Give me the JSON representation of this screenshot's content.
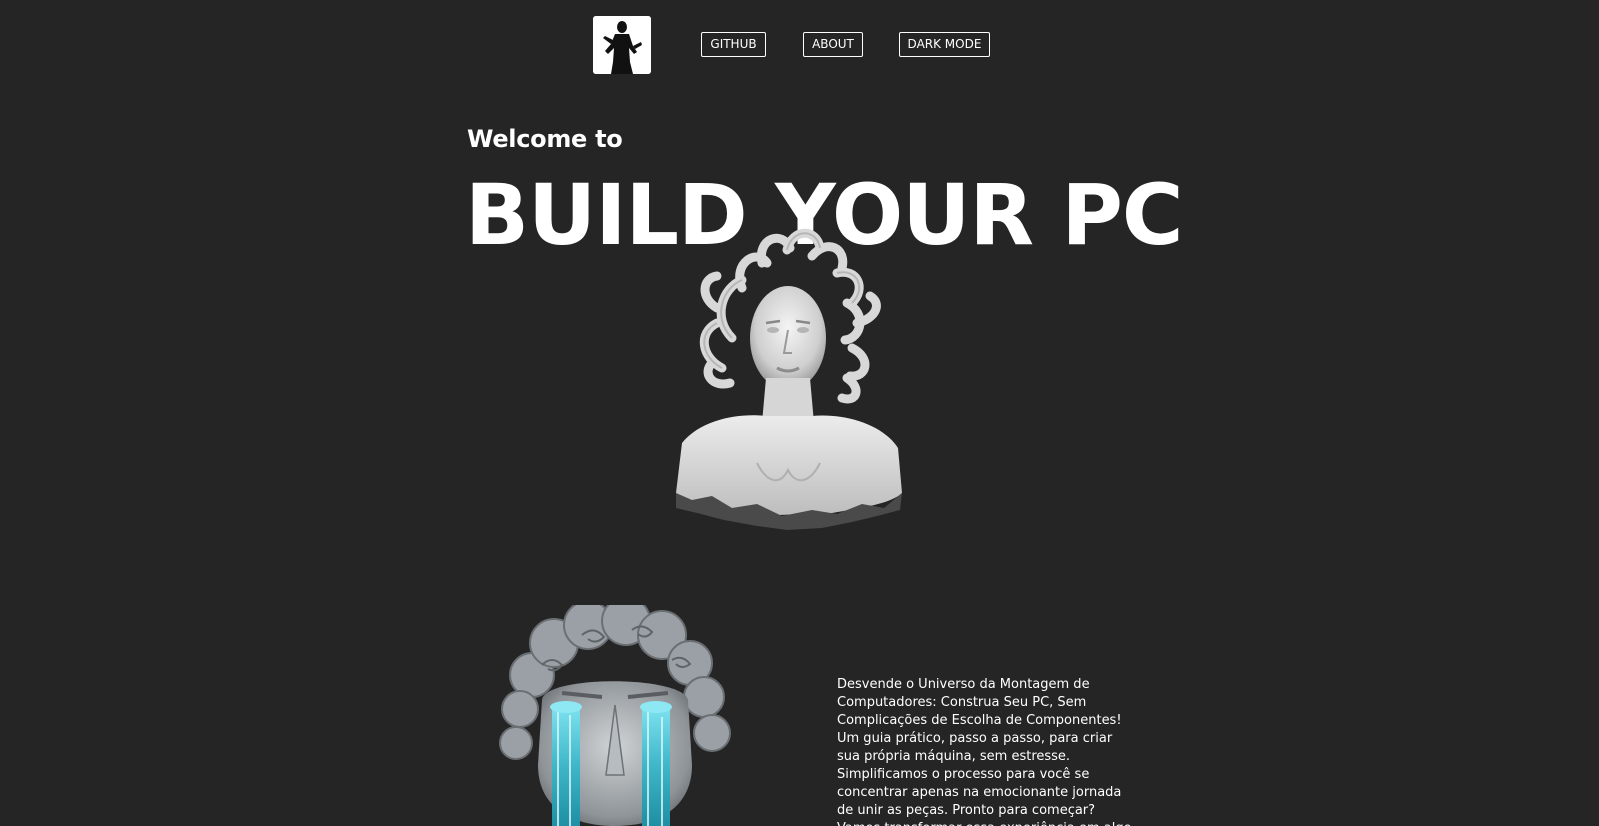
{
  "nav": {
    "logo_icon": "person-silhouette-logo-icon",
    "github_label": "GITHUB",
    "about_label": "ABOUT",
    "dark_mode_label": "DARK MODE"
  },
  "hero": {
    "welcome": "Welcome to",
    "title": "BUILD YOUR PC"
  },
  "images": {
    "medusa": "medusa-marble-bust-icon",
    "david": "david-bust-blue-tears-icon"
  },
  "intro": {
    "text": "Desvende o Universo da Montagem de Computadores: Construa Seu PC, Sem Complicações de Escolha de Componentes! Um guia prático, passo a passo, para criar sua própria máquina, sem estresse. Simplificamos o processo para você se concentrar apenas na emocionante jornada de unir as peças. Pronto para começar? Vamos transformar essa experiência em algo incrível!"
  },
  "colors": {
    "background": "#252525",
    "text": "#ffffff",
    "tears": "#3fb7c9"
  }
}
